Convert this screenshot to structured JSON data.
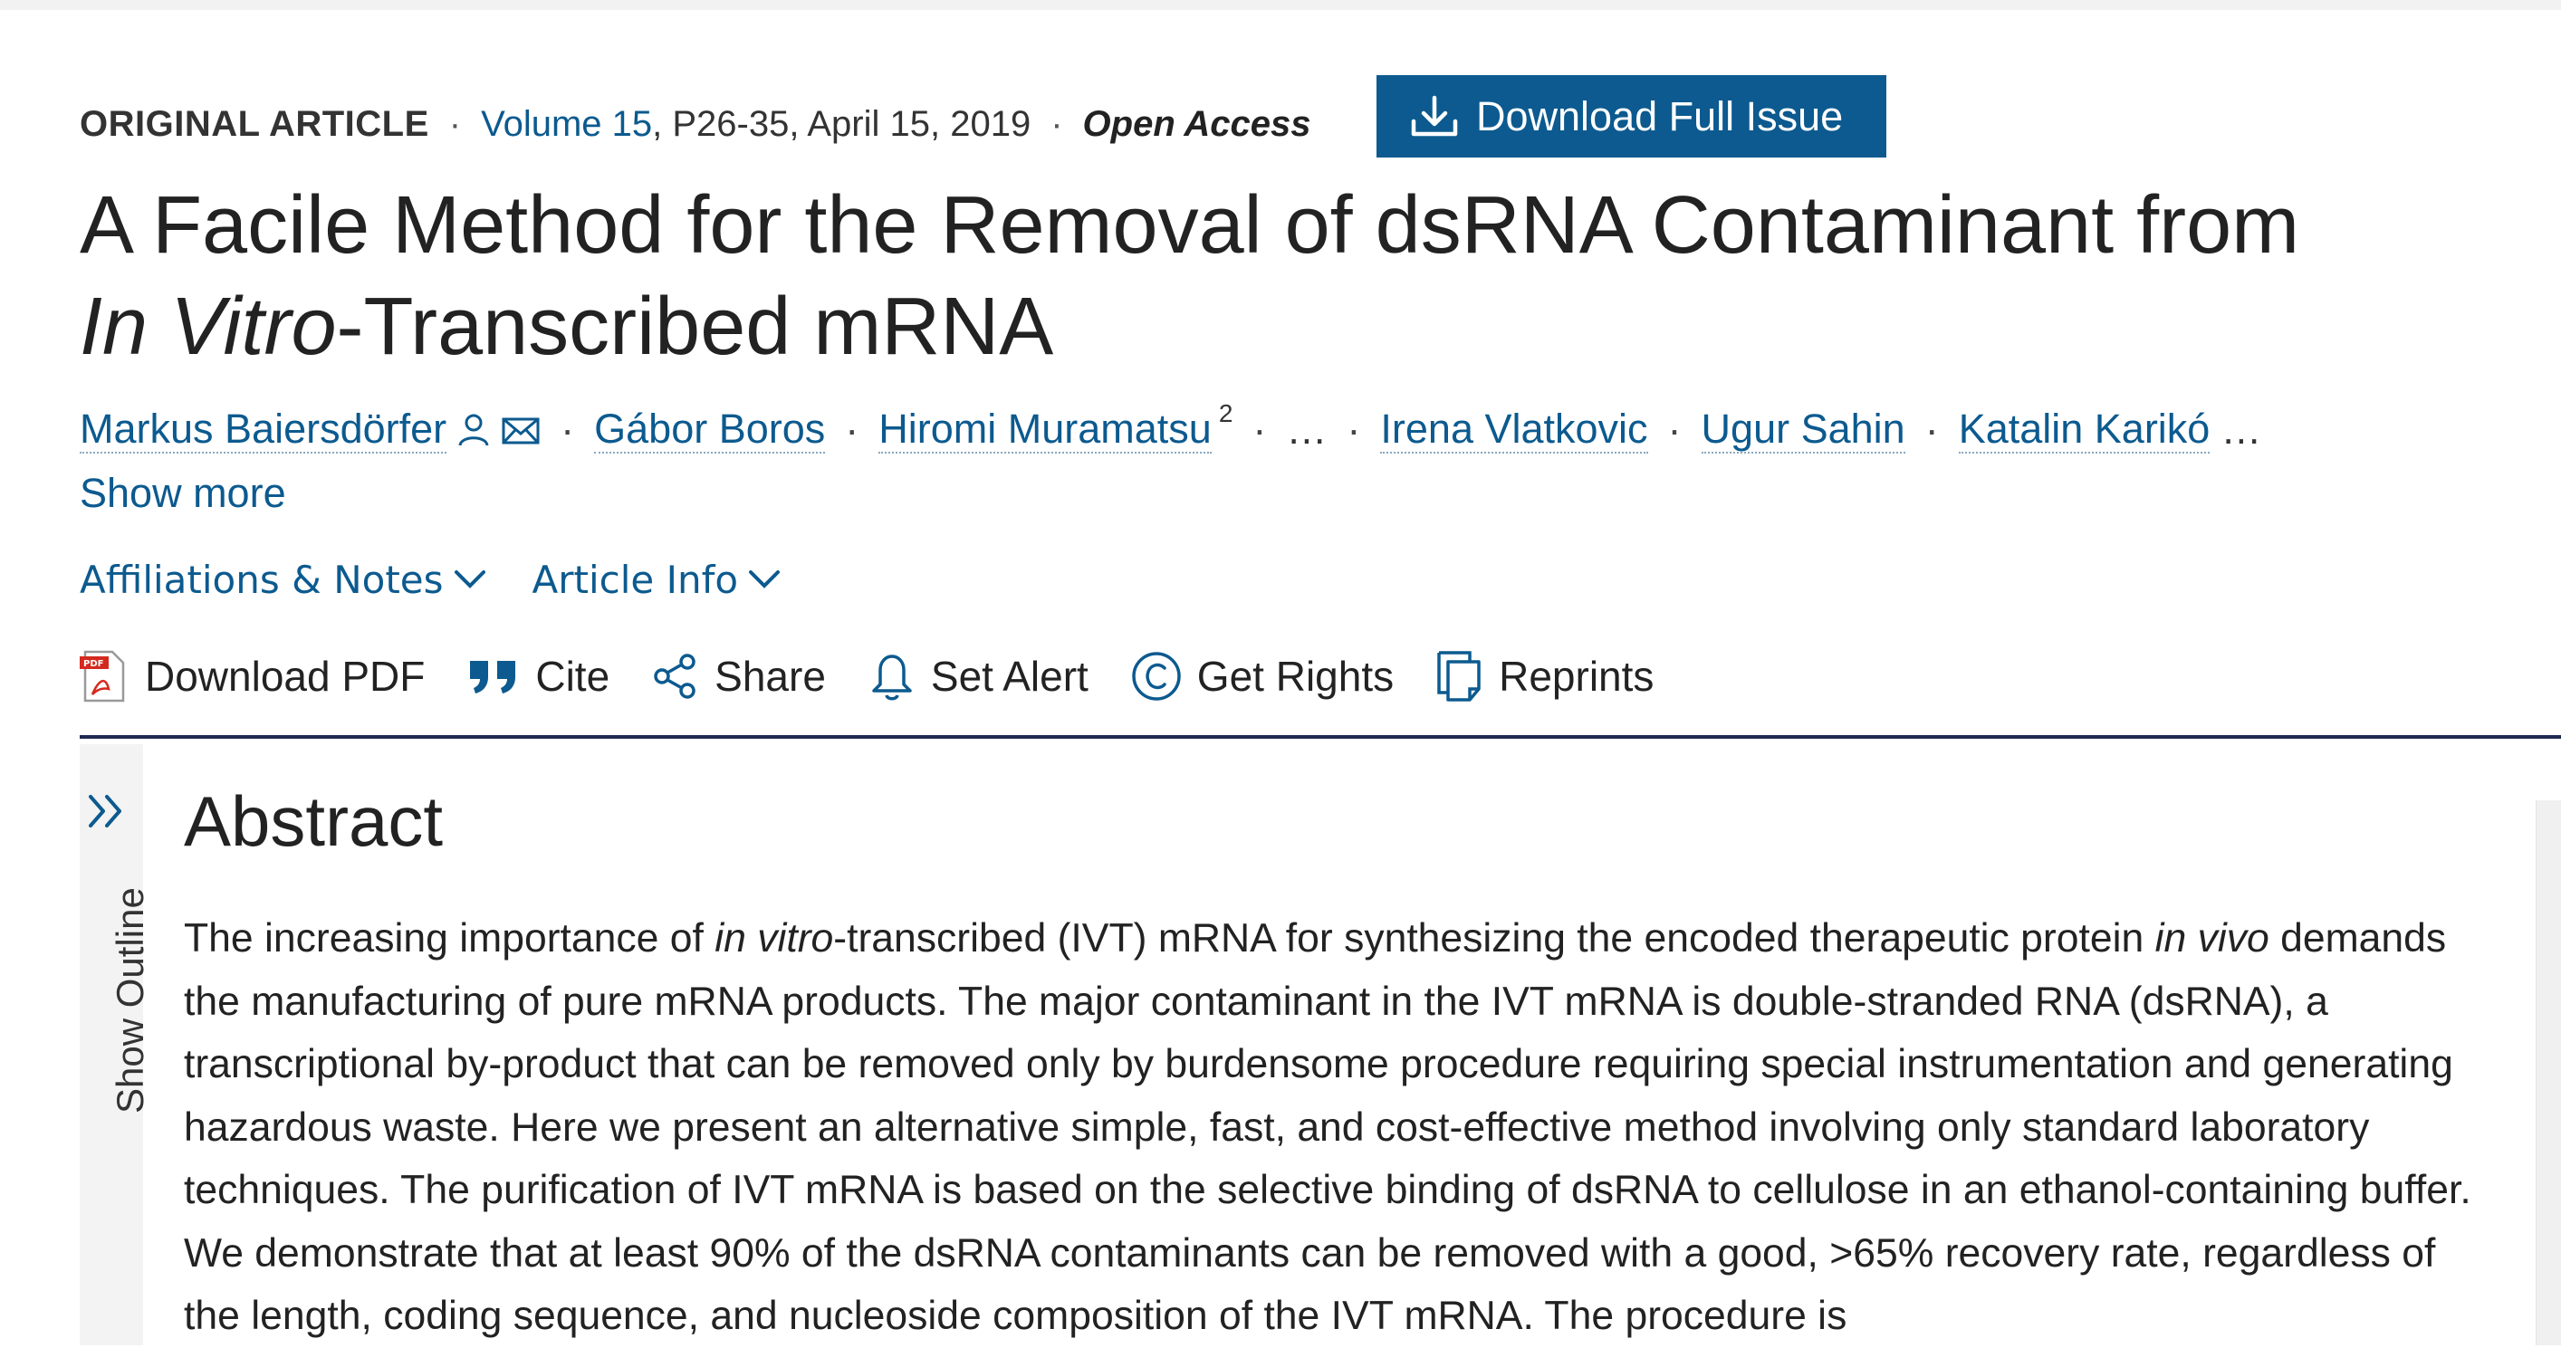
{
  "meta": {
    "article_type": "ORIGINAL ARTICLE",
    "separator": "·",
    "volume_link": "Volume 15",
    "pages_date": ", P26-35, April 15, 2019",
    "access": "Open Access",
    "download_issue_label": "Download Full Issue"
  },
  "title": {
    "line1": "A Facile Method for the Removal of dsRNA Contaminant from",
    "line2_italic": "In Vitro",
    "line2_rest": "-Transcribed mRNA"
  },
  "authors": {
    "list": [
      "Markus Baiersdörfer",
      "Gábor Boros",
      "Hiromi Muramatsu",
      "Irena Vlatkovic",
      "Ugur Sahin",
      "Katalin Karikó"
    ],
    "muramatsu_sup": "2",
    "ellipsis": "…",
    "show_more": "Show more"
  },
  "info_links": {
    "affiliations": "Affiliations & Notes",
    "article_info": "Article Info"
  },
  "toolbar": {
    "download_pdf": "Download PDF",
    "cite": "Cite",
    "share": "Share",
    "set_alert": "Set Alert",
    "get_rights": "Get Rights",
    "reprints": "Reprints"
  },
  "outline": {
    "label": "Show Outline"
  },
  "abstract": {
    "heading": "Abstract",
    "s1": "The increasing importance of ",
    "s2": "in vitro",
    "s3": "-transcribed (IVT) mRNA for synthesizing the encoded therapeutic protein ",
    "s4": "in vivo",
    "s5": " demands the manufacturing of pure mRNA products. The major contaminant in the IVT mRNA is double-stranded RNA (dsRNA), a transcriptional by-product that can be removed only by burdensome procedure requiring special instrumentation and generating hazardous waste. Here we present an alternative simple, fast, and cost-effective method involving only standard laboratory techniques. The purification of IVT mRNA is based on the selective binding of dsRNA to cellulose in an ethanol-containing buffer. We demonstrate that at least 90% of the dsRNA contaminants can be removed with a good, >65% recovery rate, regardless of the length, coding sequence, and nucleoside composition of the IVT mRNA. The procedure is"
  },
  "colors": {
    "link": "#0c5a8f",
    "button_bg": "#0c5a8f",
    "rule": "#1e2a4f",
    "pdf_red": "#d42a1e"
  }
}
